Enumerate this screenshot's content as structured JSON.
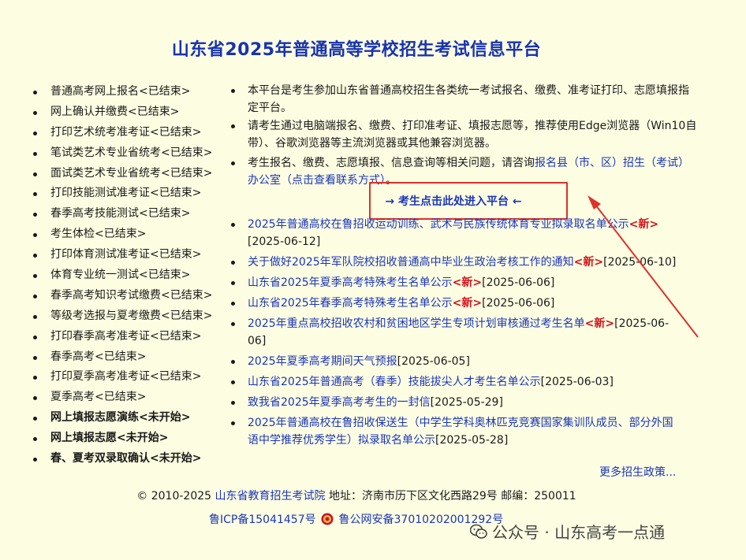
{
  "title": "山东省2025年普通高等学校招生考试信息平台",
  "left_menu": [
    {
      "label": "普通高考网上报名<已结束>",
      "bold": false
    },
    {
      "label": "网上确认并缴费<已结束>",
      "bold": false
    },
    {
      "label": "打印艺术统考准考证<已结束>",
      "bold": false
    },
    {
      "label": "笔试类艺术专业省统考<已结束>",
      "bold": false
    },
    {
      "label": "面试类艺术专业省统考<已结束>",
      "bold": false
    },
    {
      "label": "打印技能测试准考证<已结束>",
      "bold": false
    },
    {
      "label": "春季高考技能测试<已结束>",
      "bold": false
    },
    {
      "label": "考生体检<已结束>",
      "bold": false
    },
    {
      "label": "打印体育测试准考证<已结束>",
      "bold": false
    },
    {
      "label": "体育专业统一测试<已结束>",
      "bold": false
    },
    {
      "label": "春季高考知识考试缴费<已结束>",
      "bold": false
    },
    {
      "label": "等级考选报与夏考缴费<已结束>",
      "bold": false
    },
    {
      "label": "打印春季高考准考证<已结束>",
      "bold": false
    },
    {
      "label": "春季高考<已结束>",
      "bold": false
    },
    {
      "label": "打印夏季高考准考证<已结束>",
      "bold": false
    },
    {
      "label": "夏季高考<已结束>",
      "bold": false
    },
    {
      "label": "网上填报志愿演练<未开始>",
      "bold": true
    },
    {
      "label": "网上填报志愿<未开始>",
      "bold": true
    },
    {
      "label": "春、夏考双录取确认<未开始>",
      "bold": true
    }
  ],
  "notices": {
    "n1": "本平台是考生参加山东省普通高校招生各类统一考试报名、缴费、准考证打印、志愿填报指定平台。",
    "n2": "请考生通过电脑端报名、缴费、打印准考证、填报志愿等，推荐使用Edge浏览器（Win10自带）、谷歌浏览器等主流浏览器或其他兼容浏览器。",
    "n3_prefix": "考生报名、缴费、志愿填报、信息查询等相关问题，请咨询",
    "n3_link": "报名县（市、区）招生（考试）办公室（点击查看联系方式）",
    "n3_suffix": "。"
  },
  "platform_link": "→ 考生点击此处进入平台 ←",
  "news": [
    {
      "title": "2025年普通高校在鲁招收运动训练、武术与民族传统体育专业拟录取名单公示",
      "new": "<新>",
      "date": "[2025-06-12]"
    },
    {
      "title": "关于做好2025年军队院校招收普通高中毕业生政治考核工作的通知",
      "new": "<新>",
      "date": "[2025-06-10]"
    },
    {
      "title": "山东省2025年夏季高考特殊考生名单公示",
      "new": "<新>",
      "date": "[2025-06-06]"
    },
    {
      "title": "山东省2025年春季高考特殊考生名单公示",
      "new": "<新>",
      "date": "[2025-06-06]"
    },
    {
      "title": "2025年重点高校招收农村和贫困地区学生专项计划审核通过考生名单",
      "new": "<新>",
      "date": "[2025-06-06]"
    },
    {
      "title": "2025年夏季高考期间天气预报",
      "new": "",
      "date": "[2025-06-05]"
    },
    {
      "title": "山东省2025年普通高考（春季）技能拔尖人才考生名单公示",
      "new": "",
      "date": "[2025-06-03]"
    },
    {
      "title": "致我省2025年夏季高考考生的一封信",
      "new": "",
      "date": "[2025-05-29]"
    },
    {
      "title": "2025年普通高校在鲁招收保送生（中学生学科奥林匹克竞赛国家集训队成员、部分外国语中学推荐优秀学生）拟录取名单公示",
      "new": "",
      "date": "[2025-05-28]"
    }
  ],
  "more_link": "更多招生政策...",
  "footer": {
    "copyright": "© 2010-2025 ",
    "org_link": "山东省教育招生考试院",
    "address": " 地址：济南市历下区文化西路29号 邮编：250011",
    "icp": "鲁ICP备15041457号",
    "police": "鲁公网安备37010202001292号"
  },
  "watermark": "公众号 · 山东高考一点通",
  "colors": {
    "background": "#fdfde2",
    "title": "#1833b0",
    "link": "#1a36b8",
    "new": "#d3121a",
    "highlight_box": "#e0302a"
  }
}
